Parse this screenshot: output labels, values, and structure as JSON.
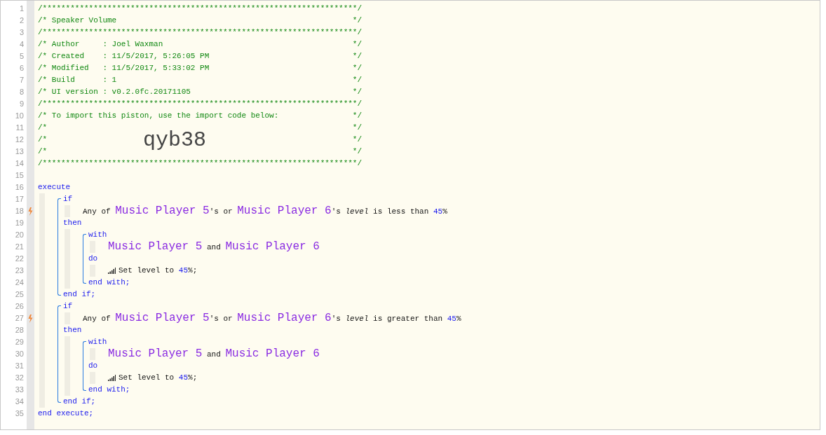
{
  "header": [
    {
      "number": "1",
      "kind": "comment",
      "text": "/********************************************************************/"
    },
    {
      "number": "2",
      "kind": "comment",
      "text": "/* Speaker Volume",
      "close": "*/"
    },
    {
      "number": "3",
      "kind": "comment",
      "text": "/********************************************************************/"
    },
    {
      "number": "4",
      "kind": "comment",
      "text": "/* Author     : Joel Waxman",
      "close": "*/"
    },
    {
      "number": "5",
      "kind": "comment",
      "text": "/* Created    : 11/5/2017, 5:26:05 PM",
      "close": "*/"
    },
    {
      "number": "6",
      "kind": "comment",
      "text": "/* Modified   : 11/5/2017, 5:33:02 PM",
      "close": "*/"
    },
    {
      "number": "7",
      "kind": "comment",
      "text": "/* Build      : 1",
      "close": "*/"
    },
    {
      "number": "8",
      "kind": "comment",
      "text": "/* UI version : v0.2.0fc.20171105",
      "close": "*/"
    },
    {
      "number": "9",
      "kind": "comment",
      "text": "/********************************************************************/"
    },
    {
      "number": "10",
      "kind": "comment",
      "text": "/* To import this piston, use the import code below:",
      "close": "*/"
    },
    {
      "number": "11",
      "kind": "comment",
      "text": "/*",
      "close": "*/"
    },
    {
      "number": "12",
      "kind": "comment",
      "text": "/*",
      "code": "qyb38",
      "close": "*/"
    },
    {
      "number": "13",
      "kind": "comment",
      "text": "/*",
      "close": "*/"
    },
    {
      "number": "14",
      "kind": "comment",
      "text": "/********************************************************************/"
    },
    {
      "number": "15",
      "kind": "blank"
    }
  ],
  "program": {
    "kind": "program",
    "sections": [
      {
        "number": "16",
        "keyword": "execute",
        "children": [
          {
            "kind": "block",
            "sections": [
              {
                "number": "17",
                "keyword": "if",
                "children": [
                  {
                    "kind": "condition",
                    "number": "18",
                    "trigger": true,
                    "parts": [
                      {
                        "kind": "text",
                        "text": "Any of "
                      },
                      {
                        "kind": "device",
                        "text": "Music Player 5"
                      },
                      {
                        "kind": "text",
                        "text": "'s or "
                      },
                      {
                        "kind": "device",
                        "text": "Music Player 6"
                      },
                      {
                        "kind": "text",
                        "text": "'s "
                      },
                      {
                        "kind": "attribute",
                        "text": "level"
                      },
                      {
                        "kind": "text",
                        "text": " is less than "
                      },
                      {
                        "kind": "value",
                        "text": "45"
                      },
                      {
                        "kind": "text",
                        "text": "%"
                      }
                    ]
                  }
                ]
              },
              {
                "number": "19",
                "keyword": "then",
                "children": [
                  {
                    "kind": "block",
                    "sections": [
                      {
                        "number": "20",
                        "keyword": "with",
                        "children": [
                          {
                            "kind": "devices",
                            "number": "21",
                            "parts": [
                              {
                                "kind": "device",
                                "text": "Music Player 5"
                              },
                              {
                                "kind": "text",
                                "text": " and "
                              },
                              {
                                "kind": "device",
                                "text": "Music Player 6"
                              }
                            ]
                          }
                        ]
                      },
                      {
                        "number": "22",
                        "keyword": "do",
                        "children": [
                          {
                            "kind": "action",
                            "number": "23",
                            "parts": [
                              {
                                "kind": "text",
                                "text": "Set level to "
                              },
                              {
                                "kind": "value",
                                "text": "45"
                              },
                              {
                                "kind": "text",
                                "text": "%;"
                              }
                            ]
                          }
                        ]
                      }
                    ],
                    "end": {
                      "number": "24",
                      "keyword": "end with;"
                    }
                  }
                ]
              }
            ],
            "end": {
              "number": "25",
              "keyword": "end if;"
            }
          },
          {
            "kind": "block",
            "sections": [
              {
                "number": "26",
                "keyword": "if",
                "children": [
                  {
                    "kind": "condition",
                    "number": "27",
                    "trigger": true,
                    "parts": [
                      {
                        "kind": "text",
                        "text": "Any of "
                      },
                      {
                        "kind": "device",
                        "text": "Music Player 5"
                      },
                      {
                        "kind": "text",
                        "text": "'s or "
                      },
                      {
                        "kind": "device",
                        "text": "Music Player 6"
                      },
                      {
                        "kind": "text",
                        "text": "'s "
                      },
                      {
                        "kind": "attribute",
                        "text": "level"
                      },
                      {
                        "kind": "text",
                        "text": " is greater than "
                      },
                      {
                        "kind": "value",
                        "text": "45"
                      },
                      {
                        "kind": "text",
                        "text": "%"
                      }
                    ]
                  }
                ]
              },
              {
                "number": "28",
                "keyword": "then",
                "children": [
                  {
                    "kind": "block",
                    "sections": [
                      {
                        "number": "29",
                        "keyword": "with",
                        "children": [
                          {
                            "kind": "devices",
                            "number": "30",
                            "parts": [
                              {
                                "kind": "device",
                                "text": "Music Player 5"
                              },
                              {
                                "kind": "text",
                                "text": " and "
                              },
                              {
                                "kind": "device",
                                "text": "Music Player 6"
                              }
                            ]
                          }
                        ]
                      },
                      {
                        "number": "31",
                        "keyword": "do",
                        "children": [
                          {
                            "kind": "action",
                            "number": "32",
                            "parts": [
                              {
                                "kind": "text",
                                "text": "Set level to "
                              },
                              {
                                "kind": "value",
                                "text": "45"
                              },
                              {
                                "kind": "text",
                                "text": "%;"
                              }
                            ]
                          }
                        ]
                      }
                    ],
                    "end": {
                      "number": "33",
                      "keyword": "end with;"
                    }
                  }
                ]
              }
            ],
            "end": {
              "number": "34",
              "keyword": "end if;"
            }
          }
        ]
      }
    ],
    "end": {
      "number": "35",
      "keyword": "end execute;"
    }
  }
}
